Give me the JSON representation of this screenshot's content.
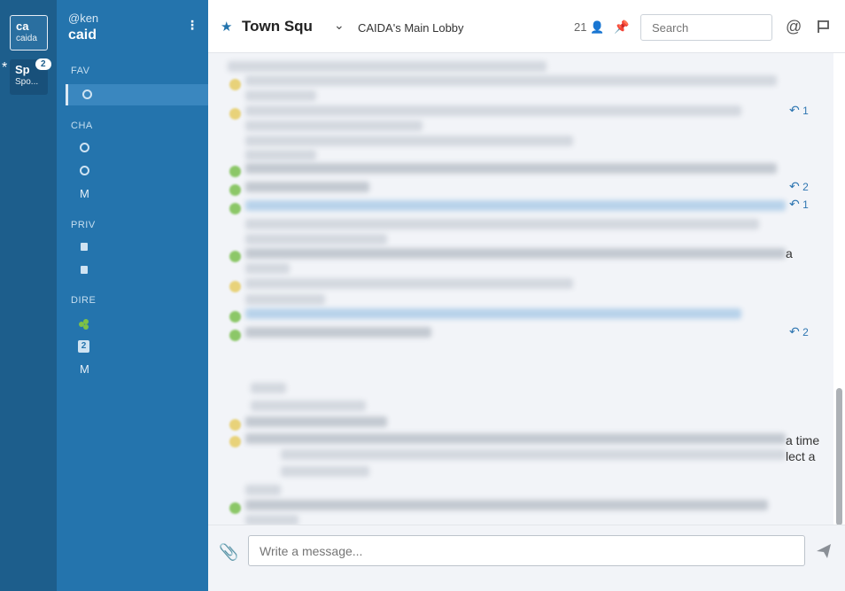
{
  "teams": [
    {
      "initials": "ca",
      "name": "caida"
    },
    {
      "initials": "Sp",
      "name": "Spo...",
      "badge": "2"
    }
  ],
  "sidebar": {
    "user": "@ken",
    "team": "caid",
    "sections": {
      "favorites": "FAV",
      "channels": "CHA",
      "private": "PRIV",
      "direct": "DIRE"
    },
    "more_label": "M",
    "dm_count": "2"
  },
  "header": {
    "title": "Town Squ",
    "purpose": "CAIDA's Main Lobby",
    "members": "21",
    "search_placeholder": "Search"
  },
  "thread_replies": [
    "1",
    "2",
    "1",
    "2"
  ],
  "visible_fragments": {
    "frag_a": "a",
    "frag_time": "a time",
    "frag_lect": "lect a"
  },
  "composer": {
    "placeholder": "Write a message..."
  },
  "colors": {
    "team_bar": "#1d5e8c",
    "sidebar": "#2474ad",
    "accent": "#2f76b1"
  }
}
